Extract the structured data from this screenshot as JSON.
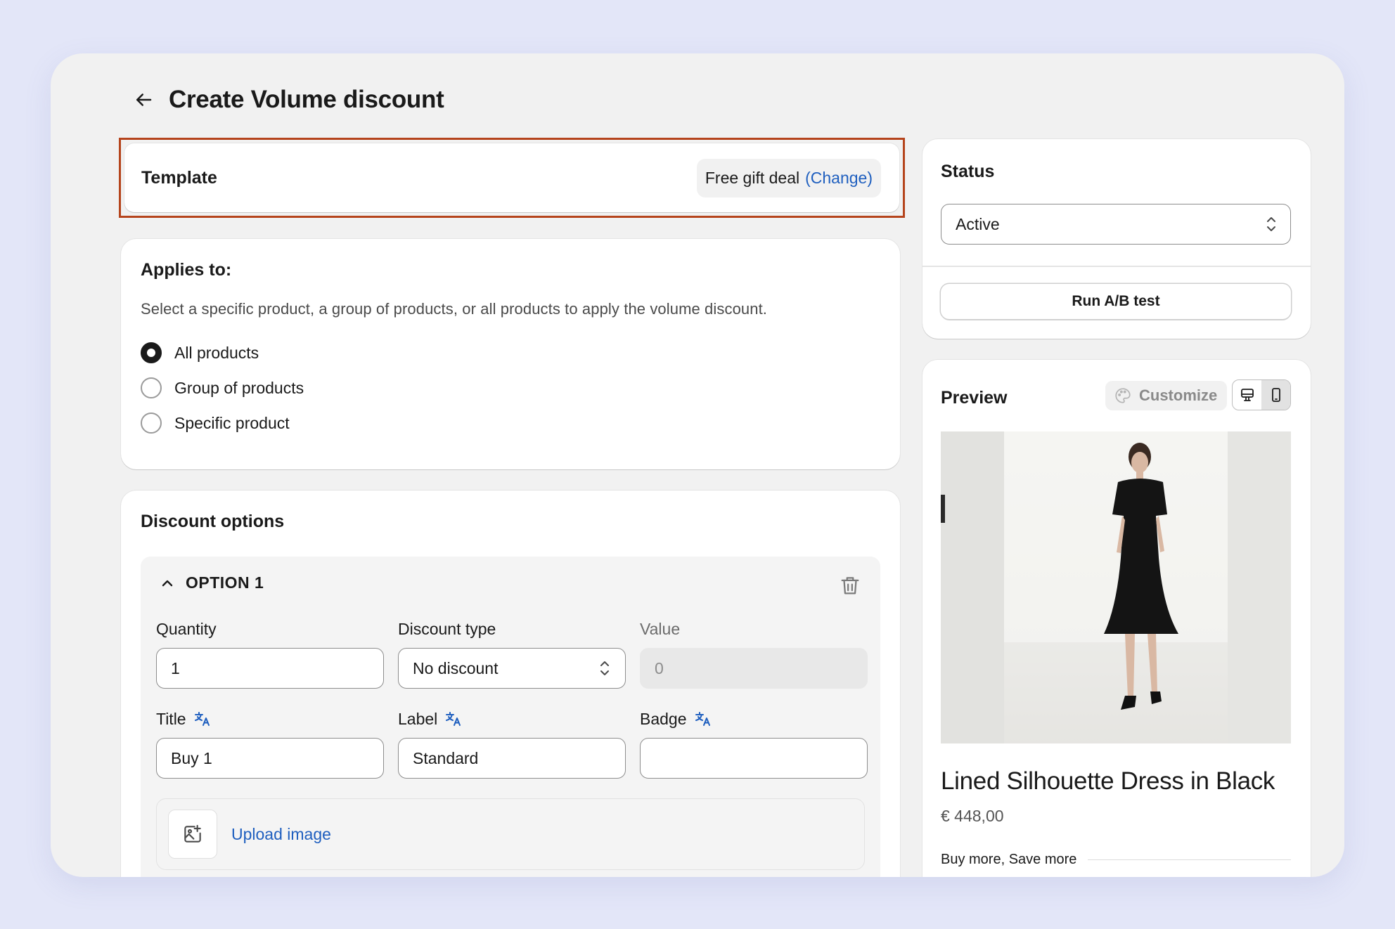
{
  "header": {
    "title": "Create Volume discount"
  },
  "template": {
    "title": "Template",
    "current": "Free gift deal",
    "change_label": "(Change)",
    "highlight_color": "#b5441c"
  },
  "applies": {
    "title": "Applies to:",
    "description": "Select a specific product, a group of products, or all products to apply the volume discount.",
    "options": [
      {
        "label": "All products",
        "checked": true
      },
      {
        "label": "Group of products",
        "checked": false
      },
      {
        "label": "Specific product",
        "checked": false
      }
    ]
  },
  "discount": {
    "title": "Discount options",
    "option_label": "OPTION 1",
    "quantity_label": "Quantity",
    "quantity_value": "1",
    "type_label": "Discount type",
    "type_value": "No discount",
    "value_label": "Value",
    "value_placeholder": "0",
    "title_label": "Title",
    "title_value": "Buy 1",
    "label_label": "Label",
    "label_value": "Standard",
    "badge_label": "Badge",
    "badge_value": "",
    "upload_label": "Upload image"
  },
  "status": {
    "title": "Status",
    "value": "Active",
    "ab_button": "Run A/B test"
  },
  "preview": {
    "title": "Preview",
    "customize_label": "Customize",
    "product_name": "Lined Silhouette Dress in Black",
    "price": "€ 448,00",
    "promo": "Buy more, Save more"
  },
  "colors": {
    "link": "#1f5fbf",
    "translate_icon": "#1f5fbf"
  }
}
